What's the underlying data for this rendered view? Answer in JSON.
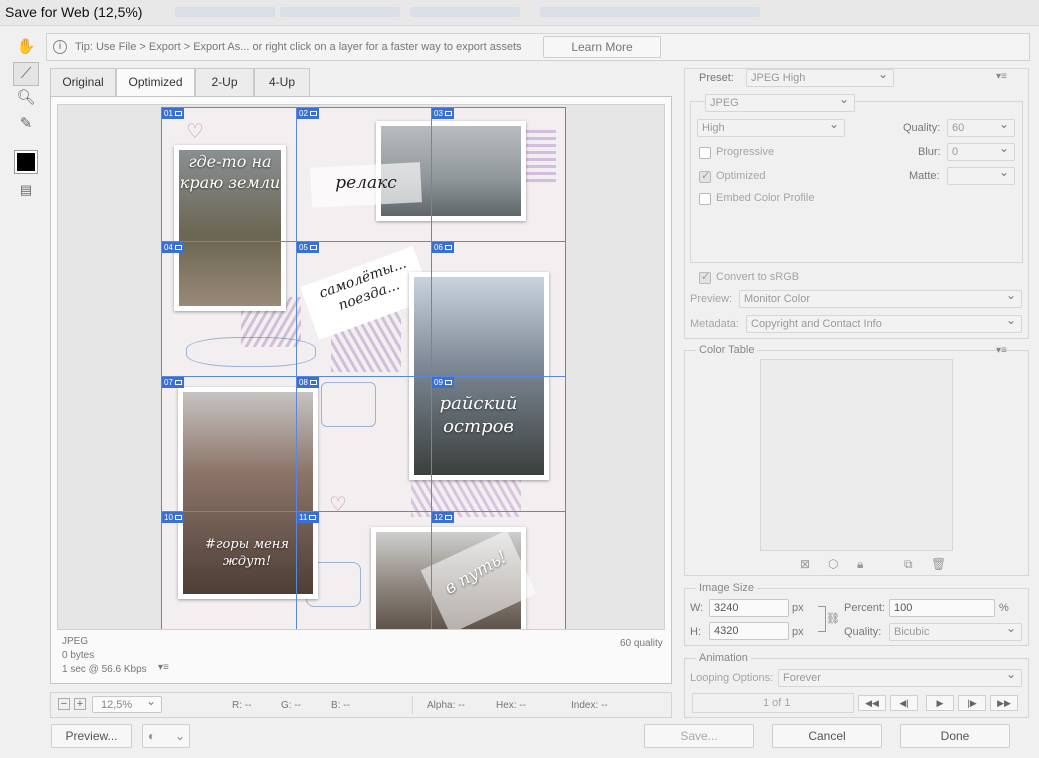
{
  "window": {
    "title": "Save for Web (12,5%)"
  },
  "tip": {
    "text": "Tip: Use File > Export > Export As...  or right click on a layer for a faster way to export assets",
    "learn_more": "Learn More"
  },
  "tabs": [
    "Original",
    "Optimized",
    "2-Up",
    "4-Up"
  ],
  "slices": [
    "01",
    "02",
    "03",
    "04",
    "05",
    "06",
    "07",
    "08",
    "09",
    "10",
    "11",
    "12"
  ],
  "artwork": {
    "caption1": "где-то на краю земли",
    "caption2": "релакс",
    "caption3": "самолёты... поезда...",
    "caption4": "райский остров",
    "caption5": "#горы меня ждут!",
    "caption6": "в путь!"
  },
  "preview_info": {
    "format": "JPEG",
    "size": "0 bytes",
    "time": "1 sec @ 56.6 Kbps",
    "quality": "60 quality"
  },
  "status": {
    "zoom": "12,5%",
    "r": "R: --",
    "g": "G: --",
    "b": "B: --",
    "alpha": "Alpha: --",
    "hex": "Hex: --",
    "index": "Index: --"
  },
  "settings": {
    "preset_label": "Preset:",
    "preset_value": "JPEG High",
    "format": "JPEG",
    "quality_level": "High",
    "quality_label": "Quality:",
    "quality_value": "60",
    "progressive": "Progressive",
    "blur_label": "Blur:",
    "blur_value": "0",
    "optimized": "Optimized",
    "matte_label": "Matte:",
    "embed": "Embed Color Profile",
    "convert": "Convert to sRGB",
    "preview_label": "Preview:",
    "preview_value": "Monitor Color",
    "metadata_label": "Metadata:",
    "metadata_value": "Copyright and Contact Info"
  },
  "color_table": {
    "title": "Color Table"
  },
  "image_size": {
    "title": "Image Size",
    "w_label": "W:",
    "w_value": "3240",
    "h_label": "H:",
    "h_value": "4320",
    "unit": "px",
    "percent_label": "Percent:",
    "percent_value": "100",
    "percent_unit": "%",
    "quality_label": "Quality:",
    "quality_value": "Bicubic"
  },
  "animation": {
    "title": "Animation",
    "looping_label": "Looping Options:",
    "looping_value": "Forever",
    "frame": "1 of 1"
  },
  "buttons": {
    "preview": "Preview...",
    "save": "Save...",
    "cancel": "Cancel",
    "done": "Done"
  },
  "colors": {
    "accent": "#3a6fd4",
    "slice_line": "#5a86dc",
    "panel": "#f0f0f0"
  }
}
